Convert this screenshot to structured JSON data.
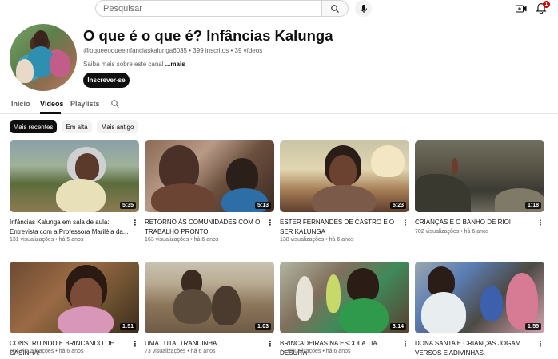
{
  "topbar": {
    "search_placeholder": "Pesquisar",
    "notification_count": "1",
    "icons": [
      "search-icon",
      "mic-icon",
      "create-video-icon",
      "bell-icon"
    ]
  },
  "channel": {
    "title": "O que é o que é? Infâncias Kalunga",
    "handle": "@oqueeoqueeinfanciaskalunga6035",
    "subscribers": "399 inscritos",
    "videos_count": "39 vídeos",
    "about": "Saiba mais sobre este canal",
    "about_more": "...mais",
    "subscribe_label": "Inscrever-se"
  },
  "tabs": [
    {
      "label": "Início",
      "active": false
    },
    {
      "label": "Vídeos",
      "active": true
    },
    {
      "label": "Playlists",
      "active": false
    }
  ],
  "chips": [
    {
      "label": "Mais recentes",
      "active": true
    },
    {
      "label": "Em alta",
      "active": false
    },
    {
      "label": "Mais antigo",
      "active": false
    }
  ],
  "videos": [
    {
      "title": "Infâncias Kalunga em sala de aula: Entrevista com a Professora Mariléia da...",
      "views": "131 visualizações",
      "age": "há 5 anos",
      "duration": "5:35"
    },
    {
      "title": "RETORNO ÀS COMUNIDADES COM O TRABALHO PRONTO",
      "views": "163 visualizações",
      "age": "há 6 anos",
      "duration": "5:13"
    },
    {
      "title": "ESTER FERNANDES DE CASTRO E O SER KALUNGA",
      "views": "138 visualizações",
      "age": "há 6 anos",
      "duration": "5:23"
    },
    {
      "title": "CRIANÇAS E O BANHO DE RIO!",
      "views": "702 visualizações",
      "age": "há 6 anos",
      "duration": "1:18"
    },
    {
      "title": "CONSTRUINDO E BRINCANDO DE CASINHA!",
      "views": "504 visualizações",
      "age": "há 6 anos",
      "duration": "1:51"
    },
    {
      "title": "UMA LUTA: TRANCINHA",
      "views": "73 visualizações",
      "age": "há 6 anos",
      "duration": "1:03"
    },
    {
      "title": "BRINCADEIRAS NA ESCOLA TIA DESUÍTA",
      "views": "77 visualizações",
      "age": "há 6 anos",
      "duration": "3:14"
    },
    {
      "title": "DONA SANTA E CRIANÇAS JOGAM VERSOS E ADIVINHAS.",
      "views": "",
      "age": "",
      "duration": "1:55"
    }
  ],
  "separator": "•",
  "kebab_glyph": "⋮",
  "colors": {
    "accent": "#0f0f0f",
    "badge": "#cc0000",
    "muted": "#606060"
  }
}
